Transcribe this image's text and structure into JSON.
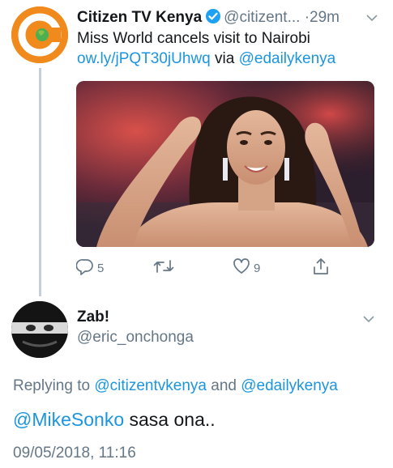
{
  "tweet": {
    "author_name": "Citizen TV Kenya",
    "handle": "@citizent...",
    "separator": "·",
    "time_ago": "29m",
    "text": "Miss World cancels visit to Nairobi",
    "link": "ow.ly/jPQT30jUhwq",
    "via_word": "via",
    "via_mention": "@edailykenya",
    "avatar_icon": "citizen-tv-logo",
    "media_icon": "photo-miss-world",
    "replies_count": "5",
    "retweets_count": "",
    "likes_count": "9",
    "colors": {
      "brand_orange": "#f08a1c",
      "link": "#1b95e0",
      "verified": "#1da1f2"
    }
  },
  "reply": {
    "author_name": "Zab!",
    "handle": "@eric_onchonga",
    "replying_prefix": "Replying to",
    "replying_to_1": "@citizentvkenya",
    "replying_and": "and",
    "replying_to_2": "@edailykenya",
    "mention": "@MikeSonko",
    "text": " sasa ona..",
    "timestamp": "09/05/2018, 11:16"
  }
}
